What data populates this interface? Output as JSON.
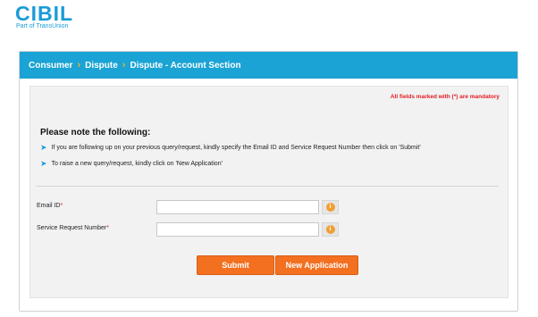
{
  "brand": {
    "logo_text": "CIBIL",
    "tagline": "Part of TransUnion",
    "primary_color": "#1a9bd7",
    "accent_color": "#f37021"
  },
  "breadcrumb": {
    "items": [
      "Consumer",
      "Dispute",
      "Dispute - Account Section"
    ],
    "separator": "›"
  },
  "form": {
    "mandatory_note": "All fields marked with (*) are mandatory",
    "note_title": "Please note the following:",
    "notes": [
      "If you are following up on your previous query/request, kindly specify the Email ID and Service Request Number then click on 'Submit'",
      "To raise a new query/request, kindly click on 'New Application'"
    ],
    "fields": [
      {
        "label": "Email ID",
        "required_mark": "*",
        "value": "",
        "placeholder": ""
      },
      {
        "label": "Service Request Number",
        "required_mark": "*",
        "value": "",
        "placeholder": ""
      }
    ],
    "info_icon": "i",
    "submit_label": "Submit",
    "new_application_label": "New Application"
  }
}
